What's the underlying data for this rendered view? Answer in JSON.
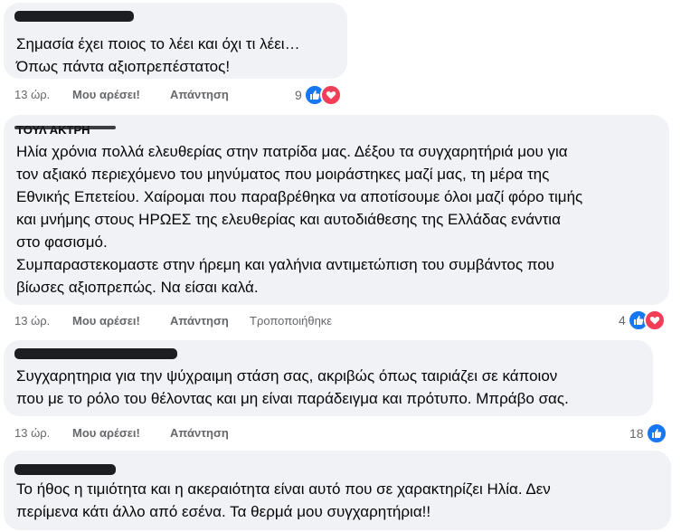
{
  "comments": [
    {
      "author": "",
      "text": "Σημασία έχει ποιος το λέει και όχι τι λέει…\nΌπως πάντα αξιοπρεπέστατος!",
      "time": "13 ώρ.",
      "like_label": "Μου αρέσει!",
      "reply_label": "Απάντηση",
      "edited_label": "",
      "reaction_count": "9",
      "reactions": [
        "like-icon",
        "love-icon"
      ]
    },
    {
      "author": "ΤΟΥΛ ΑΚΤΡΗ",
      "text": "Ηλία χρόνια πολλά ελευθερίας στην πατρίδα μας. Δέξου τα συγχαρητήριά μου για\nτον αξιακό περιεχόμενο του μηνύματος που μοιράστηκες μαζί μας, τη μέρα της\nΕθνικής Επετείου. Χαίρομαι που παραβρέθηκα να αποτίσουμε όλοι μαζί φόρο τιμής\nκαι μνήμης στους ΗΡΩΕΣ της ελευθερίας και αυτοδιάθεσης της Ελλάδας ενάντια\nστο φασισμό.\nΣυμπαραστεκομαστε στην ήρεμη και γαλήνια αντιμετώπιση του συμβάντος που\nβίωσες αξιοπρεπώς. Να είσαι καλά.",
      "time": "13 ώρ.",
      "like_label": "Μου αρέσει!",
      "reply_label": "Απάντηση",
      "edited_label": "Τροποποιήθηκε",
      "reaction_count": "4",
      "reactions": [
        "like-icon",
        "love-icon"
      ]
    },
    {
      "author": "",
      "text": "Συγχαρητηρια για την ψύχραιμη στάση σας, ακριβώς όπως ταιριάζει σε κάποιον\nπου με το ρόλο του θέλοντας και μη είναι παράδειγμα και πρότυπο. Μπράβο σας.",
      "time": "13 ώρ.",
      "like_label": "Μου αρέσει!",
      "reply_label": "Απάντηση",
      "edited_label": "",
      "reaction_count": "18",
      "reactions": [
        "like-icon"
      ]
    },
    {
      "author": "",
      "text": "Το ήθος η τιμιότητα και η ακεραιότητα είναι αυτό που σε χαρακτηρίζει Ηλία. Δεν\nπερίμενα κάτι άλλο από εσένα. Τα θερμά μου συγχαρητήρια!!",
      "time": "",
      "like_label": "",
      "reply_label": "",
      "edited_label": "",
      "reaction_count": "",
      "reactions": []
    }
  ],
  "colors": {
    "bubble": "#f0f2f5",
    "text": "#050505",
    "meta": "#65676b",
    "like": "#1877f2",
    "love": "#f33e58"
  }
}
